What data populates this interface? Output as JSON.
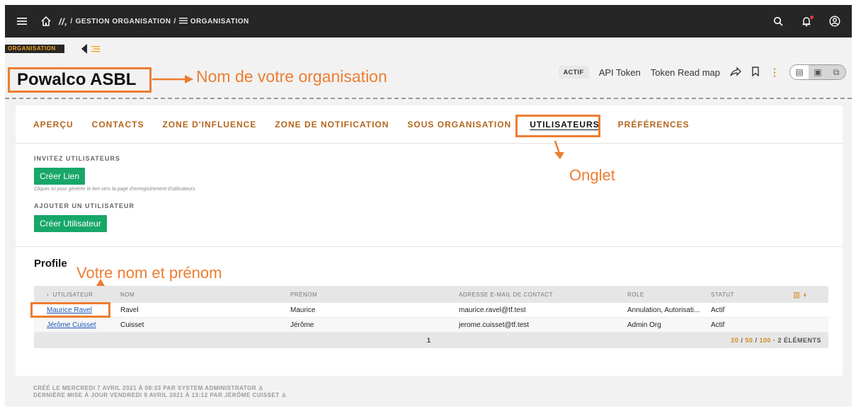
{
  "topbar": {
    "breadcrumb_root": "GESTION ORGANISATION",
    "breadcrumb_sep": "/",
    "breadcrumb_current": "ORGANISATION"
  },
  "header": {
    "tag": "ORGANISATION",
    "org_name": "Powalco ASBL",
    "status_badge": "ACTIF",
    "api_token": "API Token",
    "token_read_map": "Token Read map"
  },
  "annotations": {
    "org_name": "Nom de votre organisation",
    "tab": "Onglet",
    "user": "Votre nom et prénom"
  },
  "tabs": [
    "APERÇU",
    "CONTACTS",
    "ZONE D'INFLUENCE",
    "ZONE DE NOTIFICATION",
    "SOUS ORGANISATION",
    "UTILISATEURS",
    "PRÉFÉRENCES"
  ],
  "invite": {
    "label": "INVITEZ UTILISATEURS",
    "button": "Créer Lien",
    "hint": "Cliquer ici pour générer le lien vers la page d'enregistrement d'utilisateurs"
  },
  "add_user": {
    "label": "AJOUTER UN UTILISATEUR",
    "button": "Créer Utilisateur"
  },
  "profile": {
    "title": "Profile",
    "columns": [
      "UTILISATEUR",
      "NOM",
      "PRÉNOM",
      "ADRESSE E-MAIL DE CONTACT",
      "ROLE",
      "STATUT"
    ],
    "rows": [
      [
        "Maurice Ravel",
        "Ravel",
        "Maurice",
        "maurice.ravel@tf.test",
        "Annulation, Autorisati...",
        "Actif"
      ],
      [
        "Jérôme Cuisset",
        "Cuisset",
        "Jérôme",
        "jerome.cuisset@tf.test",
        "Admin Org",
        "Actif"
      ]
    ],
    "page": "1",
    "page_sizes": [
      "20",
      "50",
      "100"
    ],
    "count": "2 ÉLÉMENTS"
  },
  "meta": {
    "created": "CRÉÉ LE MERCREDI 7 AVRIL 2021 À 08:33 PAR SYSTEM ADMINISTRATOR",
    "updated": "DERNIÈRE MISE À JOUR VENDREDI 9 AVRIL 2021 À 13:12 PAR JÉRÔME CUISSET"
  },
  "colors": {
    "accent": "#ed7d31",
    "topbar": "#262626",
    "button": "#17a768",
    "tab": "#b5651d"
  }
}
